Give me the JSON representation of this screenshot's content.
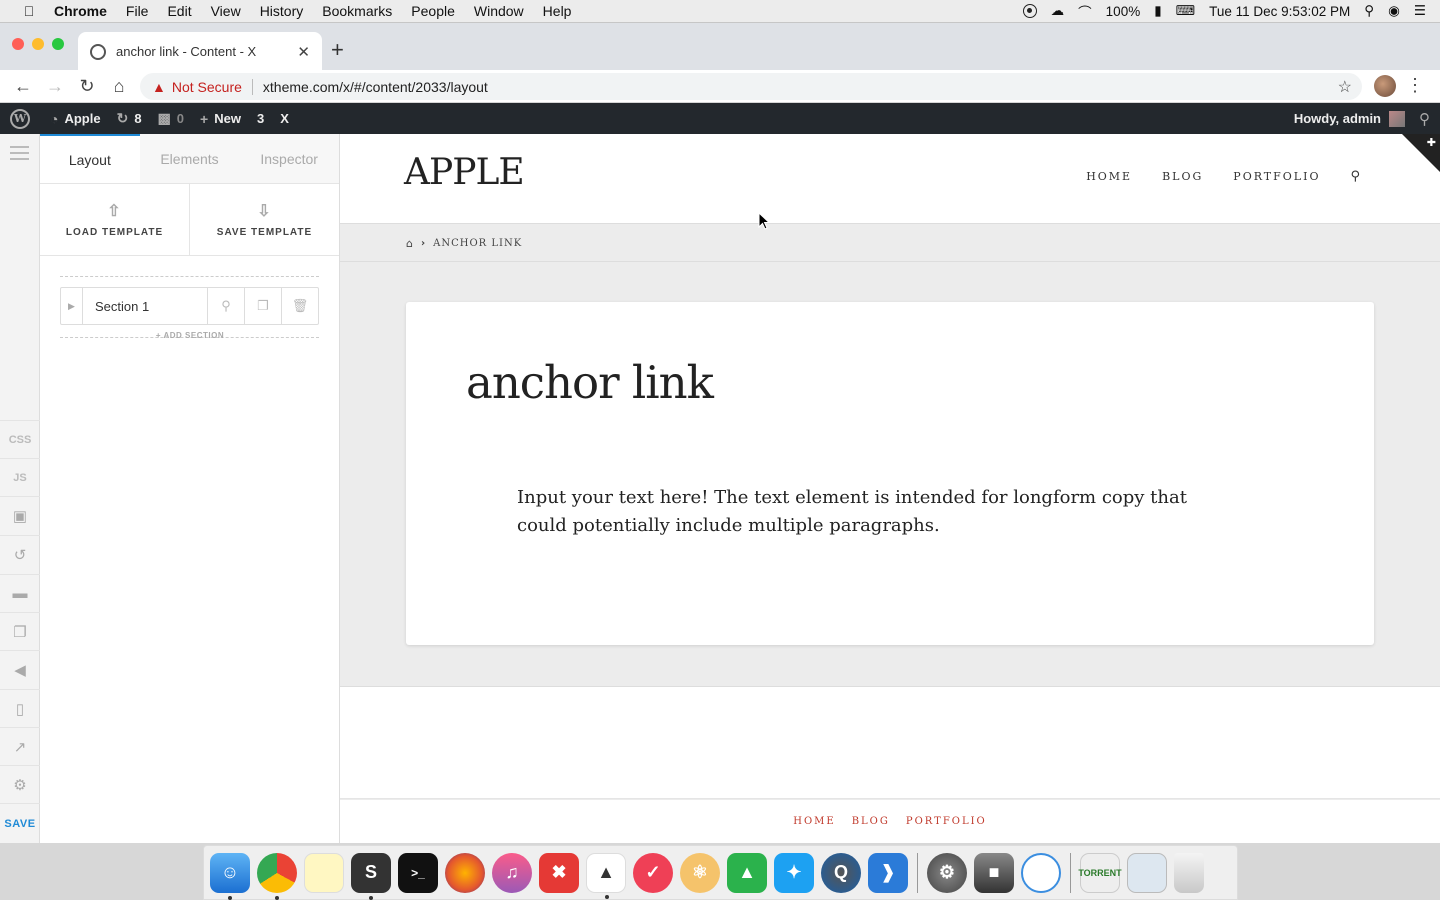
{
  "menubar": {
    "apple_icon": "apple-logo",
    "app_name": "Chrome",
    "items": [
      "File",
      "Edit",
      "View",
      "History",
      "Bookmarks",
      "People",
      "Window",
      "Help"
    ],
    "battery": "100%",
    "datetime": "Tue 11 Dec  9:53:02 PM"
  },
  "browser": {
    "tab_title": "anchor link - Content - X",
    "not_secure": "Not Secure",
    "url": "xtheme.com/x/#/content/2033/layout"
  },
  "wp_admin_bar": {
    "site_name": "Apple",
    "updates_count": "8",
    "comments_count": "0",
    "new_label": "New",
    "x_version": "3",
    "x_label": "X",
    "howdy": "Howdy, admin"
  },
  "builder": {
    "strip": {
      "css": "CSS",
      "js": "JS",
      "save": "SAVE"
    },
    "tabs": [
      "Layout",
      "Elements",
      "Inspector"
    ],
    "active_tab": "Layout",
    "load_template": "LOAD TEMPLATE",
    "save_template": "SAVE TEMPLATE",
    "sections": [
      {
        "label": "Section 1"
      }
    ],
    "add_section": "+ ADD SECTION"
  },
  "site": {
    "brand": "APPLE",
    "nav": [
      "HOME",
      "BLOG",
      "PORTFOLIO"
    ],
    "breadcrumb": "ANCHOR LINK",
    "page_title": "anchor link",
    "body_text": "Input your text here! The text element is intended for longform copy that could potentially include multiple paragraphs.",
    "footer_nav": [
      "HOME",
      "BLOG",
      "PORTFOLIO"
    ],
    "footer_color": "#c0392b"
  },
  "dock": {
    "apps": [
      "Finder",
      "Chrome",
      "Notes",
      "Sublime Text",
      "Terminal",
      "Firefox",
      "iTunes",
      "XMind",
      "Sequel Pro",
      "Pocket",
      "Atom",
      "Feedly",
      "Twitter",
      "QuickTime",
      "VS Code",
      "System Preferences",
      "Server",
      "Safari"
    ],
    "right_items": [
      "Torrent",
      "Chrome Files",
      "Trash"
    ]
  }
}
